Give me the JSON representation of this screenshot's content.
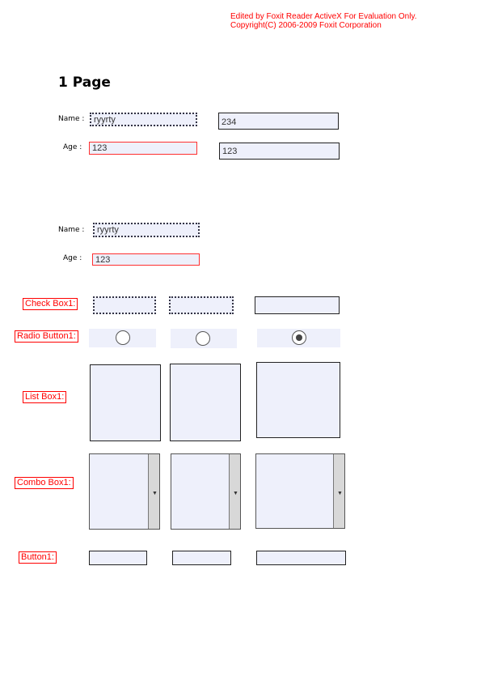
{
  "watermark": {
    "line1": "Edited by Foxit Reader ActiveX For Evaluation Only.",
    "line2": "Copyright(C) 2006-2009 Foxit Corporation"
  },
  "page_title": "1 Page",
  "section1": {
    "name_label": "Name :",
    "name_value": "ryyrty",
    "name_value2": "234",
    "age_label": "Age :",
    "age_value": "123",
    "age_value2": "123"
  },
  "section2": {
    "name_label": "Name :",
    "name_value": "ryyrty",
    "age_label": "Age :",
    "age_value": "123"
  },
  "controls": {
    "checkbox_label": "Check Box1:",
    "radio_label": "Radio Button1:",
    "radio_selected_index": 2,
    "listbox_label": "List Box1:",
    "combo_label": "Combo Box1:",
    "combo_arrow": "▼",
    "button_label": "Button1:"
  },
  "colors": {
    "watermark": "#ff0000",
    "field_fill": "#eef0fb",
    "label_border": "#ff0000"
  }
}
